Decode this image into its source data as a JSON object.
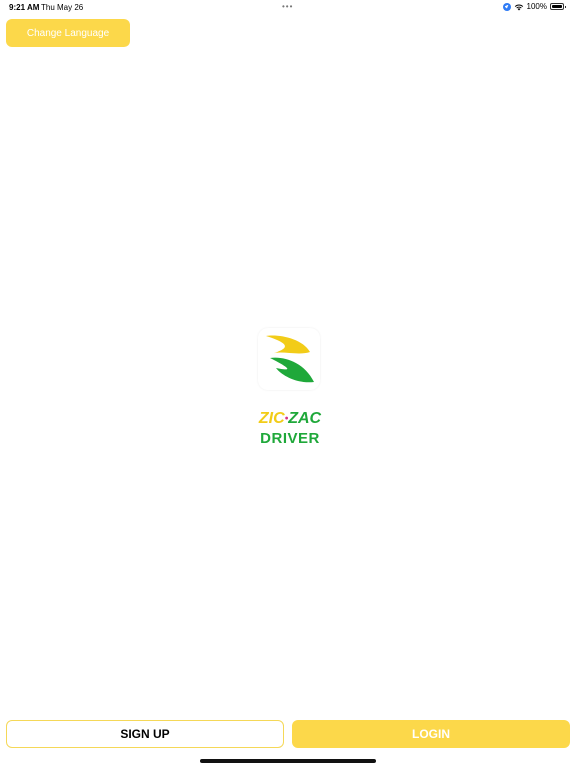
{
  "status_bar": {
    "time": "9:21 AM",
    "date": "Thu May 26",
    "dots": "•••",
    "battery": "100%",
    "battery_level": 1.0,
    "icons": [
      "location-icon",
      "wifi-icon",
      "battery-icon"
    ]
  },
  "header": {
    "change_language_label": "Change Language"
  },
  "brand": {
    "name_part1": "ZIC",
    "separator": "•",
    "name_part2": "ZAC",
    "subtitle": "DRIVER",
    "colors": {
      "yellow": "#f2cc18",
      "green": "#1fa83a",
      "pink": "#d63384"
    }
  },
  "actions": {
    "signup_label": "SIGN UP",
    "login_label": "LOGIN"
  },
  "colors": {
    "accent": "#fcd84a",
    "background": "#ffffff"
  }
}
